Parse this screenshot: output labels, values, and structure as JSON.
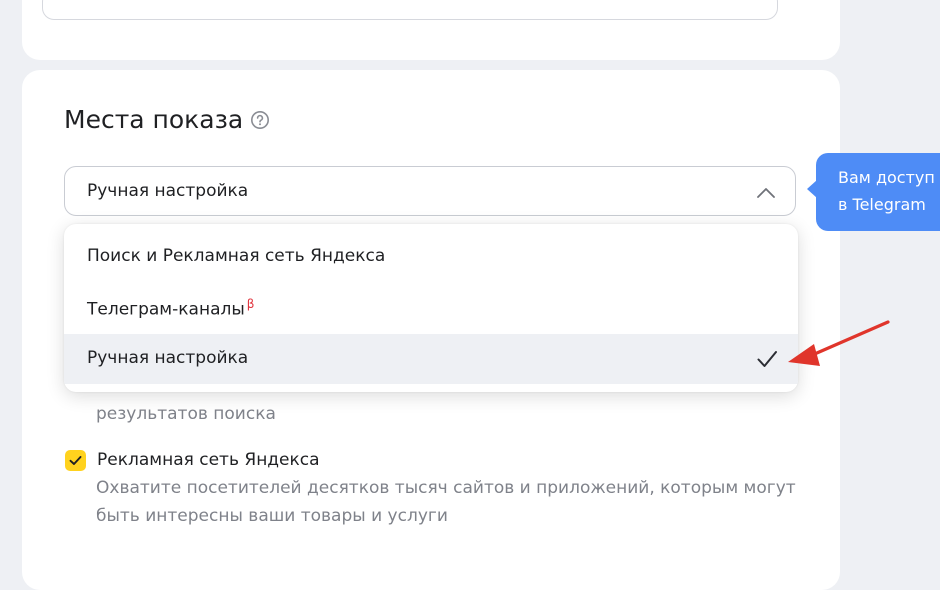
{
  "section": {
    "title": "Места показа"
  },
  "select": {
    "value": "Ручная настройка"
  },
  "tooltip": {
    "line1": "Вам доступ",
    "line2": "в Telegram"
  },
  "dropdown": {
    "options": [
      {
        "label": "Поиск и Рекламная сеть Яндекса"
      },
      {
        "label": "Телеграм-каналы",
        "badge": "β"
      },
      {
        "label": "Ручная настройка",
        "selected": true
      }
    ]
  },
  "background": {
    "partial_text": "результатов поиска",
    "network_label": "Рекламная сеть Яндекса",
    "network_checked": true,
    "network_desc_line1": "Охватите посетителей десятков тысяч сайтов и приложений, которым могут",
    "network_desc_line2": "быть интересны ваши товары и услуги"
  },
  "colors": {
    "accent_yellow": "#ffd21e",
    "tooltip_blue": "#4e8cf6",
    "arrow_red": "#e0352b",
    "beta_red": "#e0323c"
  }
}
